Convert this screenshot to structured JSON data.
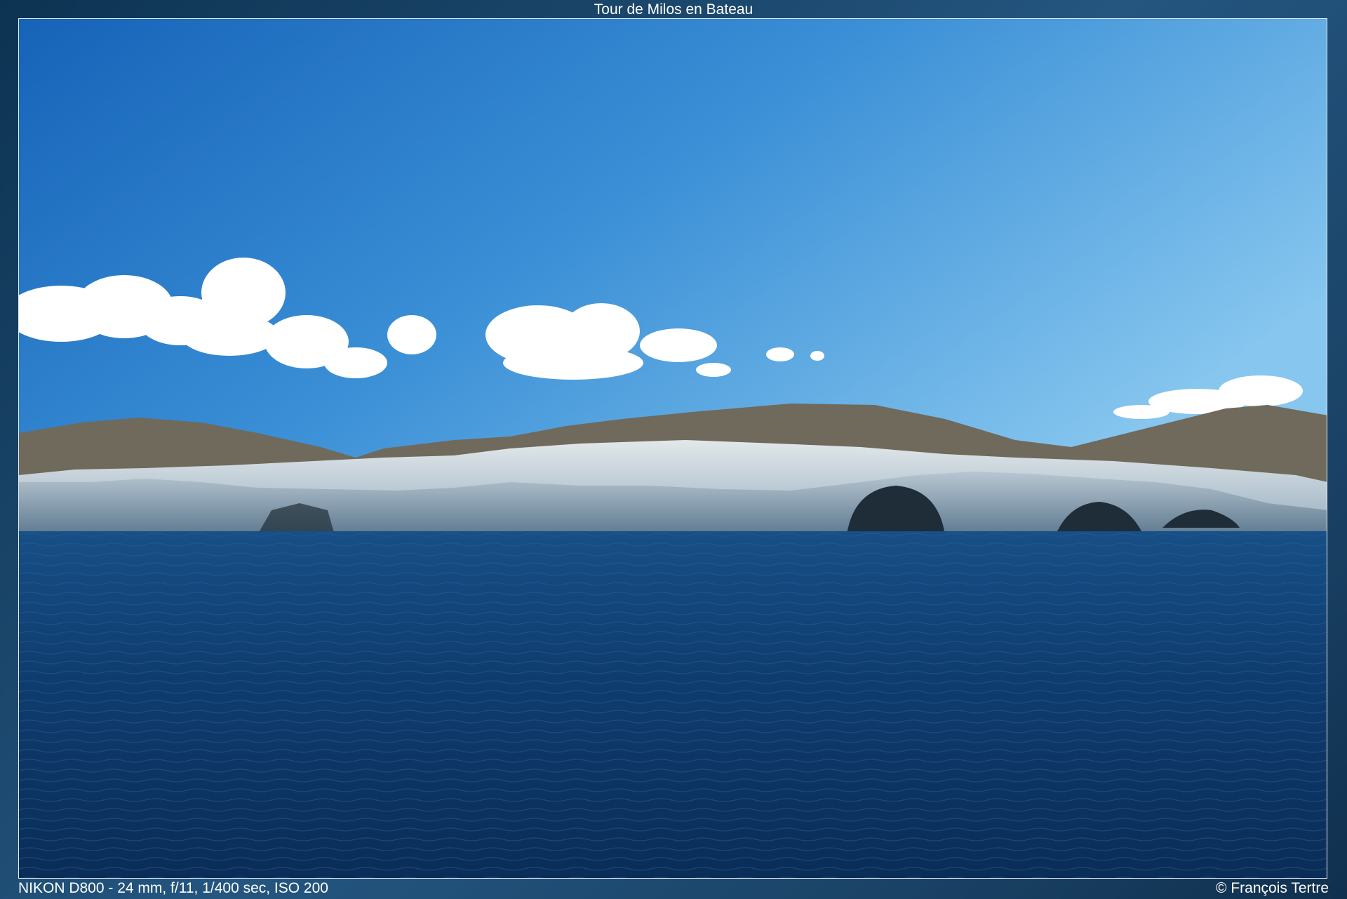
{
  "header": {
    "title": "Tour de Milos en Bateau"
  },
  "photo": {
    "subject": "white volcanic rock coastline with sea caves under blue sky",
    "colors": {
      "sky_top": "#1a6fc4",
      "sky_horizon": "#7cc0ee",
      "sea": "#0f3f75",
      "rock": "#cdd9e2"
    }
  },
  "footer": {
    "exif": "NIKON D800 - 24 mm, f/11, 1/400 sec, ISO 200",
    "copyright": "© François Tertre"
  }
}
